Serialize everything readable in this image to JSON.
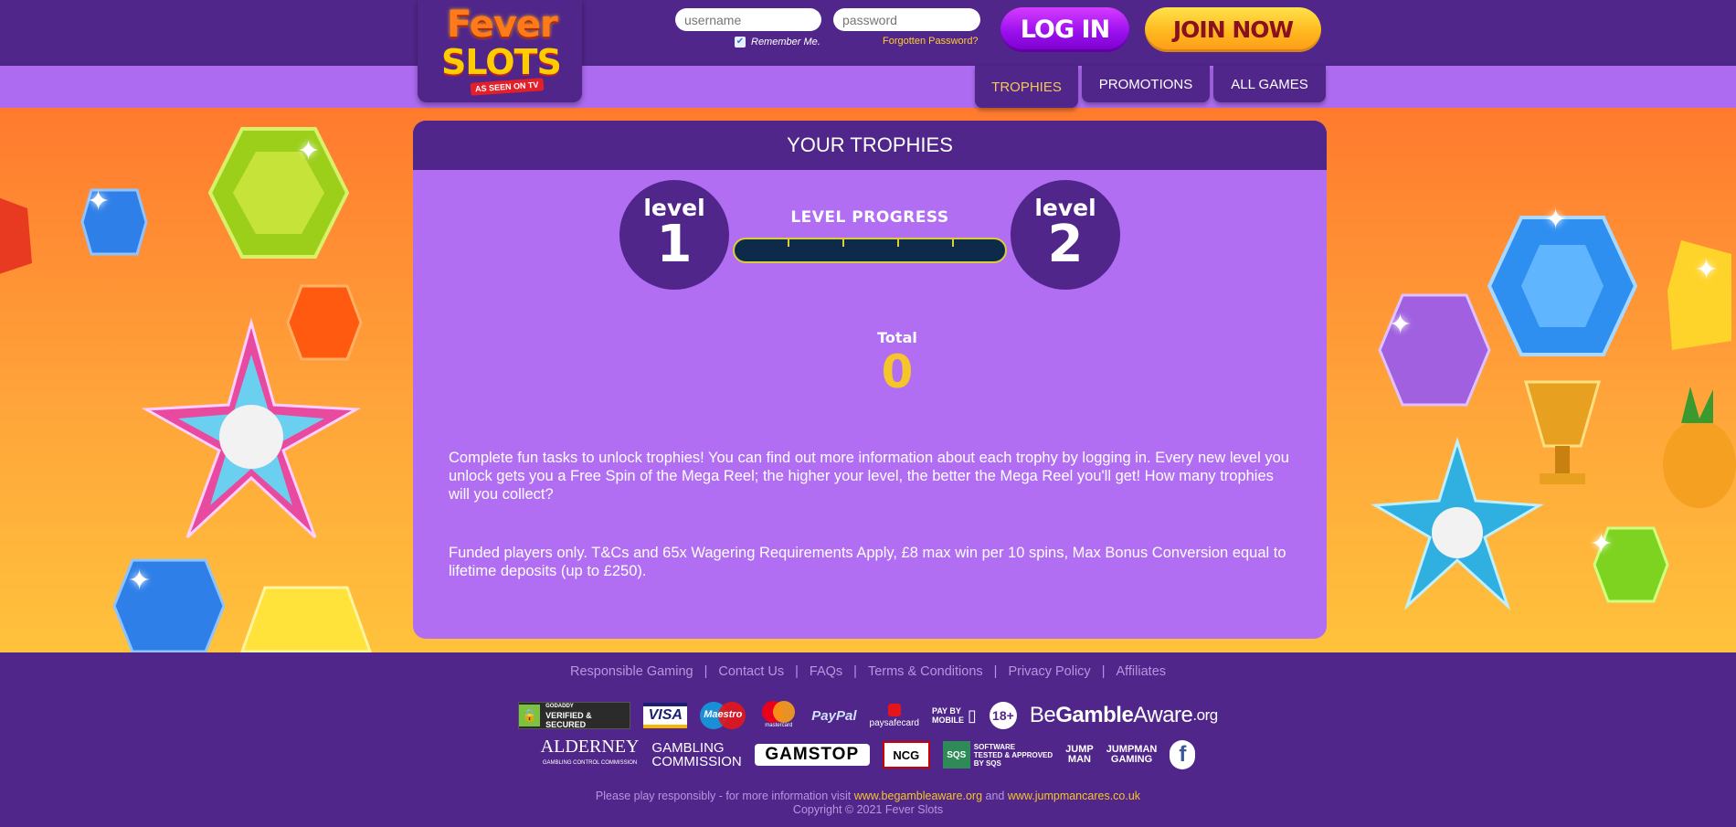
{
  "header": {
    "logo_text_top": "Fever",
    "logo_text_bottom": "SLOTS",
    "logo_tagline": "AS SEEN ON TV",
    "username_placeholder": "username",
    "password_placeholder": "password",
    "remember_label": "Remember Me.",
    "remember_checked": true,
    "forgot_label": "Forgotten Password?",
    "login_label": "LOG IN",
    "join_label": "JOIN NOW"
  },
  "nav": {
    "tabs": [
      {
        "label": "TROPHIES",
        "active": true
      },
      {
        "label": "PROMOTIONS",
        "active": false
      },
      {
        "label": "ALL GAMES",
        "active": false
      }
    ]
  },
  "trophies": {
    "title": "YOUR TROPHIES",
    "current_level_word": "level",
    "current_level": "1",
    "next_level_word": "level",
    "next_level": "2",
    "progress_label": "LEVEL PROGRESS",
    "progress_fraction": 0,
    "total_label": "Total",
    "total_value": "0",
    "description": "Complete fun tasks to unlock trophies! You can find out more information about each trophy by logging in. Every new level you unlock gets you a Free Spin of the Mega Reel; the higher your level, the better the Mega Reel you'll get! How many trophies will you collect?",
    "terms": "Funded players only. T&Cs and 65x Wagering Requirements Apply, £8 max win per 10 spins, Max Bonus Conversion equal to lifetime deposits (up to £250)."
  },
  "footer": {
    "links": [
      "Responsible Gaming",
      "Contact Us",
      "FAQs",
      "Terms & Conditions",
      "Privacy Policy",
      "Affiliates"
    ],
    "badges": {
      "godaddy_l1": "GODADDY",
      "godaddy_l2": "VERIFIED & SECURED",
      "visa": "VISA",
      "maestro": "Maestro",
      "mastercard": "mastercard",
      "paypal": "PayPal",
      "paysafecard": "paysafecard",
      "paybymobile_l1": "PAY BY",
      "paybymobile_l2": "MOBILE",
      "age": "18+",
      "begambleaware_be": "Be",
      "begambleaware_gamble": "Gamble",
      "begambleaware_aware": "Aware",
      "begambleaware_org": ".org",
      "alderney": "ALDERNEY",
      "alderney_sub": "GAMBLING CONTROL COMMISSION",
      "gc_l1": "GAMBLING",
      "gc_l2": "COMMISSION",
      "gamstop": "GAMSTOP",
      "ncg": "NCG",
      "sqs_l1": "SOFTWARE",
      "sqs_l2": "TESTED & APPROVED",
      "sqs_l3": "BY SQS",
      "jumpman_a": "JUMP",
      "jumpman_b": "MAN",
      "jumpman_gaming_l1": "JUMPMAN",
      "jumpman_gaming_l2": "GAMING",
      "facebook": "f"
    },
    "note_prefix": "Please play responsibly - for more information visit ",
    "note_link1": "www.begambleaware.org",
    "note_and": " and ",
    "note_link2": "www.jumpmancares.co.uk",
    "copyright": "Copyright © 2021 Fever Slots"
  }
}
